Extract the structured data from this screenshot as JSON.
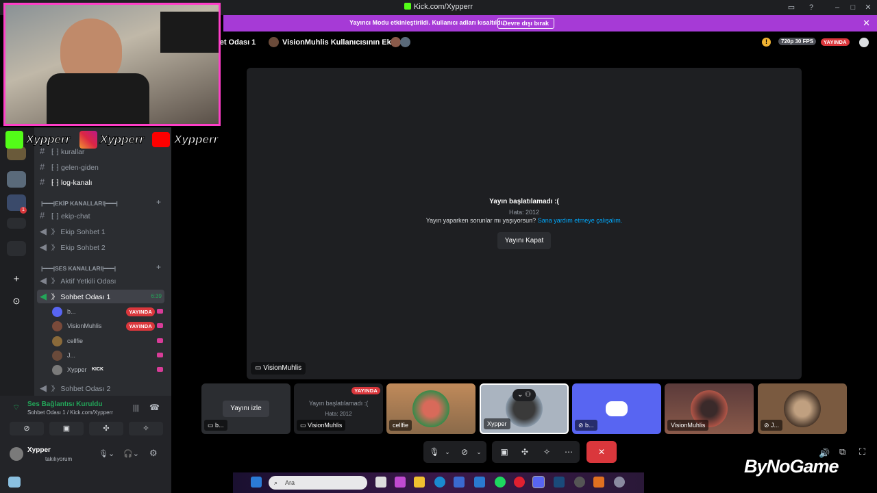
{
  "window": {
    "title": "Kick.com/Xypperr"
  },
  "banner": {
    "message": "Yayıncı Modu etkinleştirildi. Kullanıcı adları kısaltıldı.",
    "button": "Devre dışı bırak"
  },
  "stage_header": {
    "channel": "bet Odası 1",
    "screen_title": "VisionMuhlis Kullanıcısının Ekranı",
    "quality": "720p 30 FPS",
    "live": "YAYINDA"
  },
  "stage": {
    "error_title": "Yayın başlatılamadı :(",
    "error_code": "Hata: 2012",
    "help_text": "Yayın yaparken sorunlar mı yaşıyorsun?",
    "help_link": "Sana yardım etmeye çalışalım.",
    "stop_button": "Yayını Kapat",
    "viewer_name": "VisionMuhlis"
  },
  "tiles": [
    {
      "name": "b...",
      "button": "Yayını izle"
    },
    {
      "name": "VisionMuhlis",
      "live": "YAYINDA",
      "error": "Yayın başlatılamadı :(",
      "code": "Hata: 2012"
    },
    {
      "name": "cellfie"
    },
    {
      "name": "Xypper"
    },
    {
      "name": "b..."
    },
    {
      "name": "VisionMuhlis"
    },
    {
      "name": "J..."
    }
  ],
  "channels": {
    "text": [
      {
        "label": "kurallar"
      },
      {
        "label": "gelen-giden"
      },
      {
        "label": "log-kanalı"
      }
    ],
    "category_team": "|━━━|EKİP KANALLARI|━━━|",
    "team": [
      {
        "label": "ekip-chat"
      },
      {
        "label": "Ekip Sohbet 1"
      },
      {
        "label": "Ekip Sohbet 2"
      }
    ],
    "category_voice": "|━━━|SES KANALLARI|━━━|",
    "voice": [
      {
        "label": "Aktif Yetkili Odası"
      },
      {
        "label": "Sohbet Odası 1",
        "time": "6:39"
      },
      {
        "label": "Sohbet Odası 2"
      }
    ]
  },
  "members": [
    {
      "name": "b...",
      "badge": "YAYINDA",
      "color": "#5865f2"
    },
    {
      "name": "VisionMuhlis",
      "badge": "YAYINDA",
      "color": "#7a4a3a"
    },
    {
      "name": "cellfie",
      "badge": "",
      "color": "#8a6a3a"
    },
    {
      "name": "J...",
      "badge": "",
      "color": "#6a4a3a"
    },
    {
      "name": "Xypper",
      "badge": "KICK",
      "color": "#7a7a7a"
    }
  ],
  "voice_panel": {
    "status": "Ses Bağlantısı Kuruldu",
    "location": "Sohbet Odası 1 / Kick.com/Xypperr",
    "user": "Xypper",
    "user_status": "takılıyorum"
  },
  "taskbar": {
    "search_placeholder": "Ara"
  },
  "overlay": {
    "handle_kick": "Xypperr",
    "handle_ig": "Xypperr",
    "handle_yt": "Xypperr",
    "watermark": "ByNoGame"
  },
  "colors": {
    "accent": "#a63ad6",
    "live": "#da373c",
    "connected": "#23a559",
    "discord": "#5865f2",
    "kick": "#53fc18"
  }
}
